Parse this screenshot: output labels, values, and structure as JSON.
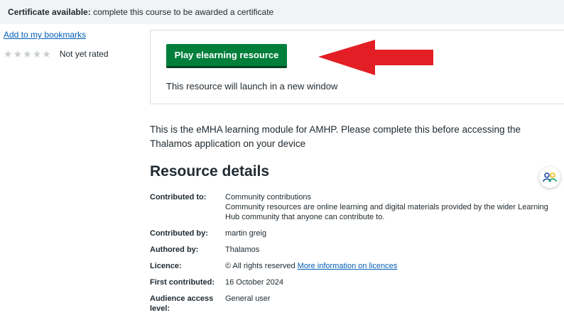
{
  "banner": {
    "label": "Certificate available:",
    "text": "complete this course to be awarded a certificate"
  },
  "sidebar": {
    "bookmark_label": "Add to my bookmarks",
    "rating": {
      "stars_filled": 0,
      "stars_total": 5,
      "text": "Not yet rated"
    }
  },
  "launch": {
    "button_label": "Play elearning resource",
    "note": "This resource will launch in a new window"
  },
  "arrow_color": "#e31e24",
  "description": "This is the eMHA learning module for AMHP. Please complete this before accessing the Thalamos application on your device",
  "details": {
    "title": "Resource details",
    "contributed_to": {
      "label": "Contributed to:",
      "value": "Community contributions",
      "note": "Community resources are online learning and digital materials provided by the wider Learning Hub community that anyone can contribute to."
    },
    "contributed_by": {
      "label": "Contributed by:",
      "value": "martin greig"
    },
    "authored_by": {
      "label": "Authored by:",
      "value": "Thalamos"
    },
    "licence": {
      "label": "Licence:",
      "value": "© All rights reserved",
      "link": "More information on licences"
    },
    "first_contributed": {
      "label": "First contributed:",
      "value": "16 October 2024"
    },
    "audience": {
      "label": "Audience access level:",
      "value": "General user"
    }
  },
  "colors": {
    "brand_green": "#007f3b",
    "link_blue": "#005eb8",
    "banner_bg": "#f0f4f5"
  },
  "icons": {
    "star": "star-icon",
    "accessibility": "accessibility-icon",
    "arrow": "red-arrow-annotation"
  }
}
